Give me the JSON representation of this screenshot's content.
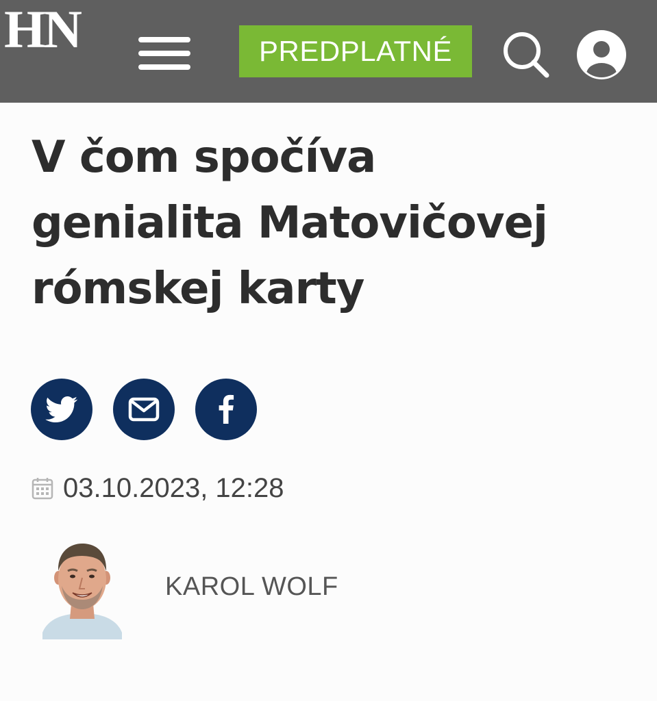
{
  "header": {
    "logo_text": "HN",
    "menu_icon": "hamburger-menu-icon",
    "subscribe_label": "PREDPLATNÉ",
    "search_icon": "search-icon",
    "account_icon": "user-account-icon",
    "background_color": "#5f5f5f",
    "subscribe_color": "#7ab935"
  },
  "article": {
    "title_lines": [
      "V čom spočíva",
      "genialita Matovičovej",
      "rómskej karty"
    ],
    "share_buttons": [
      {
        "icon": "twitter-icon"
      },
      {
        "icon": "email-icon"
      },
      {
        "icon": "facebook-icon"
      }
    ],
    "share_color": "#0f2f5e",
    "date_icon": "calendar-icon",
    "date": "03.10.2023, 12:28",
    "author": {
      "name": "KAROL WOLF",
      "avatar_icon": "author-photo"
    }
  }
}
